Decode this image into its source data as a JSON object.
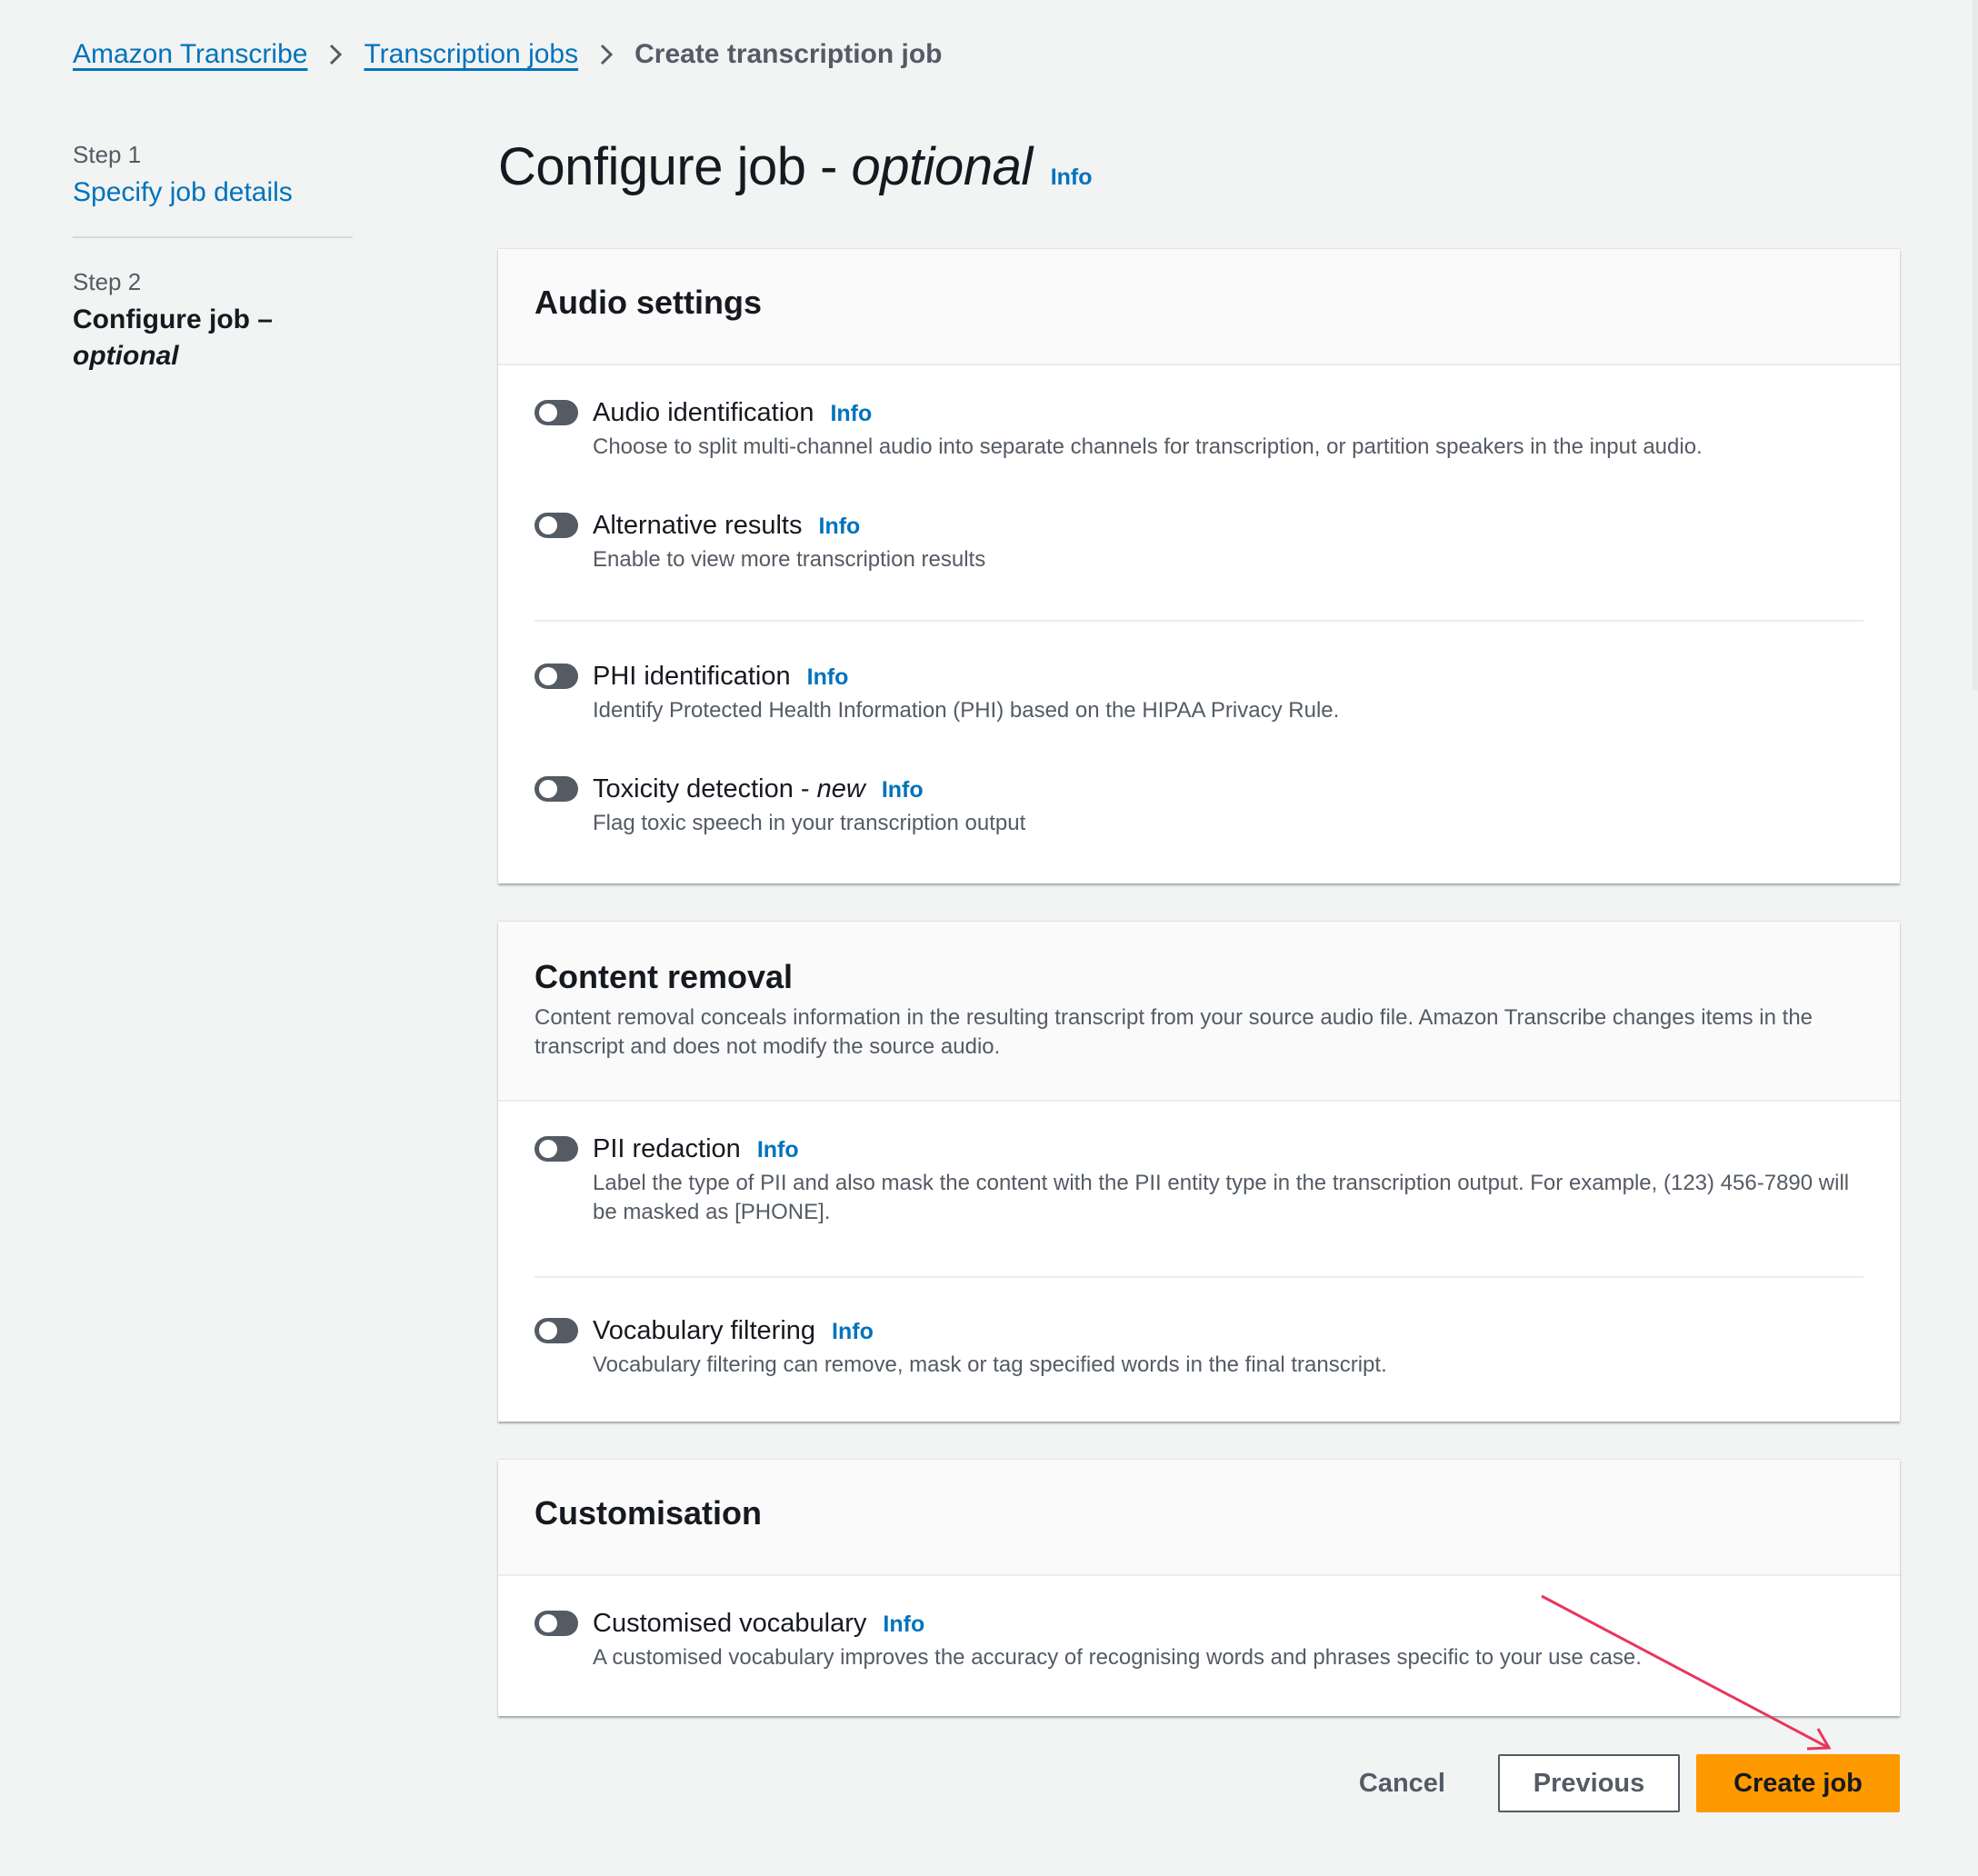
{
  "breadcrumb": {
    "items": [
      "Amazon Transcribe",
      "Transcription jobs"
    ],
    "current": "Create transcription job"
  },
  "steps": {
    "step1_label": "Step 1",
    "step1_title": "Specify job details",
    "step2_label": "Step 2",
    "step2_title": "Configure job –",
    "step2_title_em": "optional"
  },
  "page": {
    "title": "Configure job - ",
    "title_em": "optional",
    "info": "Info"
  },
  "audio_settings": {
    "title": "Audio settings",
    "options": [
      {
        "label": "Audio identification",
        "info": "Info",
        "desc": "Choose to split multi-channel audio into separate channels for transcription, or partition speakers in the input audio.",
        "enabled": false
      },
      {
        "label": "Alternative results",
        "info": "Info",
        "desc": "Enable to view more transcription results",
        "enabled": false
      },
      {
        "label": "PHI identification",
        "info": "Info",
        "desc": "Identify Protected Health Information (PHI) based on the HIPAA Privacy Rule.",
        "enabled": false
      },
      {
        "label": "Toxicity detection - ",
        "label_em": "new",
        "info": "Info",
        "desc": "Flag toxic speech in your transcription output",
        "enabled": false
      }
    ]
  },
  "content_removal": {
    "title": "Content removal",
    "desc": "Content removal conceals information in the resulting transcript from your source audio file. Amazon Transcribe changes items in the transcript and does not modify the source audio.",
    "options": [
      {
        "label": "PII redaction",
        "info": "Info",
        "desc": "Label the type of PII and also mask the content with the PII entity type in the transcription output. For example, (123) 456-7890 will be masked as [PHONE].",
        "enabled": false
      },
      {
        "label": "Vocabulary filtering",
        "info": "Info",
        "desc": "Vocabulary filtering can remove, mask or tag specified words in the final transcript.",
        "enabled": false
      }
    ]
  },
  "customisation": {
    "title": "Customisation",
    "options": [
      {
        "label": "Customised vocabulary",
        "info": "Info",
        "desc": "A customised vocabulary improves the accuracy of recognising words and phrases specific to your use case.",
        "enabled": false
      }
    ]
  },
  "actions": {
    "cancel": "Cancel",
    "previous": "Previous",
    "create": "Create job"
  },
  "colors": {
    "link": "#0073bb",
    "primary_button": "#ff9900",
    "toggle_off": "#545b64",
    "annotation_arrow": "#e8365d"
  }
}
